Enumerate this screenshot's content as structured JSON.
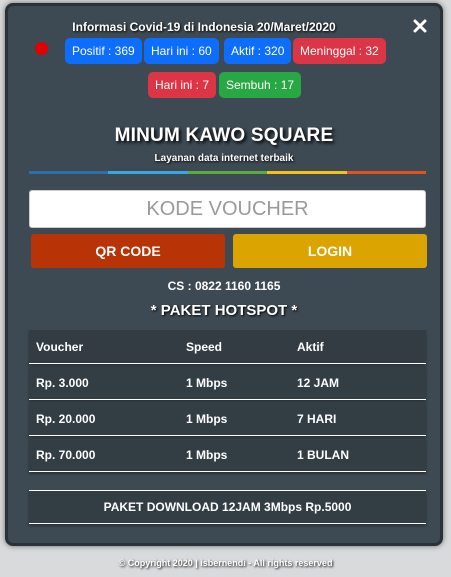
{
  "covid": {
    "title": "Informasi Covid-19 di Indonesia 20/Maret/2020",
    "badges": [
      "Positif : 369",
      "Hari ini : 60",
      "Aktif : 320",
      "Meninggal : 32",
      "Hari ini : 7",
      "Sembuh : 17"
    ]
  },
  "brand": {
    "title": "MINUM KAWO SQUARE",
    "tagline": "Layanan data internet terbaik"
  },
  "colors": {
    "rainbow": [
      "#2f6fa8",
      "#39a6dd",
      "#5aaa3c",
      "#f3c31a",
      "#e0531e"
    ]
  },
  "login": {
    "placeholder": "KODE VOUCHER",
    "qr_label": "QR CODE",
    "login_label": "LOGIN"
  },
  "cs": "CS : 0822 1160 1165",
  "paket": {
    "title": "* PAKET HOTSPOT *",
    "headers": [
      "Voucher",
      "Speed",
      "Aktif"
    ],
    "rows": [
      [
        "Rp. 3.000",
        "1 Mbps",
        "12 JAM"
      ],
      [
        "Rp. 20.000",
        "1 Mbps",
        "7 HARI"
      ],
      [
        "Rp. 70.000",
        "1 Mbps",
        "1 BULAN"
      ]
    ],
    "download": "PAKET DOWNLOAD 12JAM 3Mbps Rp.5000"
  },
  "footer": "© Copyright 2020 | isbernendi - All rights reserved"
}
